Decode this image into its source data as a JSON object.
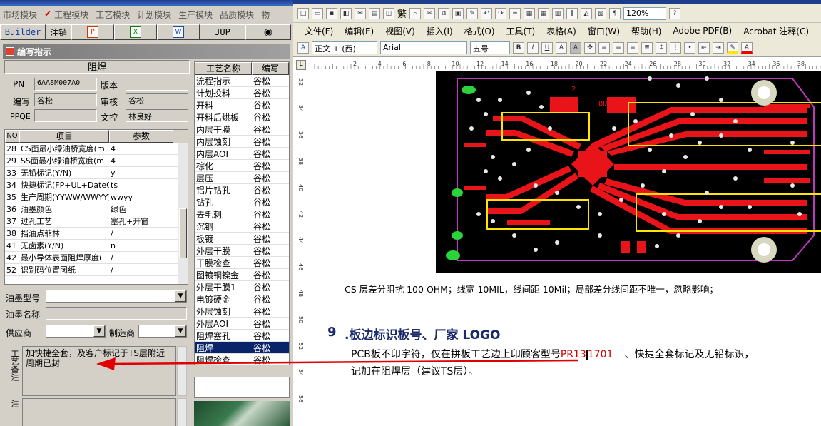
{
  "left_menu": {
    "items": [
      "市场模块",
      "工程模块",
      "工艺模块",
      "计划模块",
      "生产模块",
      "品质模块",
      "物"
    ]
  },
  "left_toolbar": {
    "builder": "Builder",
    "logout": "注销",
    "jup": "JUP"
  },
  "window_title": "编写指示",
  "form": {
    "process_name": "阻焊",
    "pn_label": "PN",
    "pn_value": "6AA8M007A0",
    "version_label": "版本",
    "version_value": "",
    "author_label": "编写",
    "author_value": "谷松",
    "reviewer_label": "审核",
    "reviewer_value": "谷松",
    "ppqe_label": "PPQE",
    "ppqe_value": "",
    "doc_control_label": "文控",
    "doc_control_value": "林良好"
  },
  "params": {
    "headers": [
      "NO",
      "项目",
      "参数"
    ],
    "rows": [
      {
        "no": "28",
        "item": "CS面最小绿油桥宽度(m",
        "value": "4"
      },
      {
        "no": "29",
        "item": "SS面最小绿油桥宽度(m",
        "value": "4"
      },
      {
        "no": "33",
        "item": "无铅标记(Y/N)",
        "value": "y"
      },
      {
        "no": "34",
        "item": "快捷标记(FP+UL+DateCo",
        "value": "ts"
      },
      {
        "no": "35",
        "item": "生产周期(YYWW/WWYY)",
        "value": "wwyy"
      },
      {
        "no": "36",
        "item": "油墨颜色",
        "value": "绿色"
      },
      {
        "no": "37",
        "item": "过孔工艺",
        "value": "塞孔+开窗"
      },
      {
        "no": "38",
        "item": "挡油点菲林",
        "value": "/"
      },
      {
        "no": "41",
        "item": "无卤素(Y/N)",
        "value": "n"
      },
      {
        "no": "42",
        "item": "最小导体表面阻焊厚度(",
        "value": "/"
      },
      {
        "no": "52",
        "item": "识别码位置图纸",
        "value": "/"
      }
    ]
  },
  "ink": {
    "type_label": "油墨型号",
    "name_label": "油墨名称",
    "supplier_label": "供应商",
    "mfg_label": "制造商"
  },
  "remark": {
    "label": "工艺备注",
    "text": "加快捷全套，及客户标记于TS层附近周期已封",
    "model_label": "型号备注"
  },
  "process_list": {
    "headers": [
      "工艺名称",
      "编写"
    ],
    "rows": [
      {
        "name": "流程指示",
        "author": "谷松"
      },
      {
        "name": "计划投料",
        "author": "谷松"
      },
      {
        "name": "开料",
        "author": "谷松"
      },
      {
        "name": "开料后烘板",
        "author": "谷松"
      },
      {
        "name": "内层干膜",
        "author": "谷松"
      },
      {
        "name": "内层蚀刻",
        "author": "谷松"
      },
      {
        "name": "内层AOI",
        "author": "谷松"
      },
      {
        "name": "棕化",
        "author": "谷松"
      },
      {
        "name": "层压",
        "author": "谷松"
      },
      {
        "name": "铝片钻孔",
        "author": "谷松"
      },
      {
        "name": "钻孔",
        "author": "谷松"
      },
      {
        "name": "去毛刺",
        "author": "谷松"
      },
      {
        "name": "沉铜",
        "author": "谷松"
      },
      {
        "name": "板镀",
        "author": "谷松"
      },
      {
        "name": "外层干膜",
        "author": "谷松"
      },
      {
        "name": "干膜检查",
        "author": "谷松"
      },
      {
        "name": "图镀铜镍金",
        "author": "谷松"
      },
      {
        "name": "外层干膜1",
        "author": "谷松"
      },
      {
        "name": "电镀硬金",
        "author": "谷松"
      },
      {
        "name": "外层蚀刻",
        "author": "谷松"
      },
      {
        "name": "外层AOI",
        "author": "谷松"
      },
      {
        "name": "阻焊塞孔",
        "author": "谷松"
      },
      {
        "name": "阻焊",
        "author": "谷松",
        "selected": true
      },
      {
        "name": "阻焊检查",
        "author": "谷松"
      }
    ]
  },
  "word": {
    "menu": [
      "文件(F)",
      "编辑(E)",
      "视图(V)",
      "插入(I)",
      "格式(O)",
      "工具(T)",
      "表格(A)",
      "窗口(W)",
      "帮助(H)",
      "Adobe PDF(B)",
      "Acrobat 注释(C)"
    ],
    "toolbar_text": "繁",
    "zoom": "120%",
    "style": "正文 + (西)",
    "font": "Arial",
    "size": "五号",
    "ruler_ticks": [
      "2",
      "4",
      "6",
      "8",
      "10",
      "12",
      "14",
      "16",
      "18",
      "20",
      "22",
      "24",
      "26",
      "28",
      "30",
      "32",
      "34",
      "36",
      "38",
      "40"
    ],
    "vruler_ticks": [
      "32",
      "34",
      "36",
      "38",
      "40",
      "42",
      "44",
      "46",
      "48",
      "50",
      "52",
      "54",
      "56"
    ],
    "pcb_labels": [
      "2",
      "BIAS",
      "GND"
    ],
    "caption": "CS 层差分阻抗 100 OHM；线宽 10MIL，线间距 10Mil；局部差分线间距不唯一，忽略影响；",
    "heading_num": "9",
    "heading": ".板边标识板号、厂家 LOGO",
    "para1_a": "PCB板不印字符，仅在拼板工艺边上印顾客型号",
    "para1_red": "PR13",
    "para1_red2": "1701",
    "para1_b": "、快捷全套标记及无铅标识，",
    "para2": "记加在阻焊层（建议TS层）。"
  },
  "colors": {
    "selection": "#0a246a",
    "pcb_bg": "#000000",
    "trace": "#e8141a",
    "highlight_box": "#ffe600",
    "arrow": "#e00000"
  }
}
